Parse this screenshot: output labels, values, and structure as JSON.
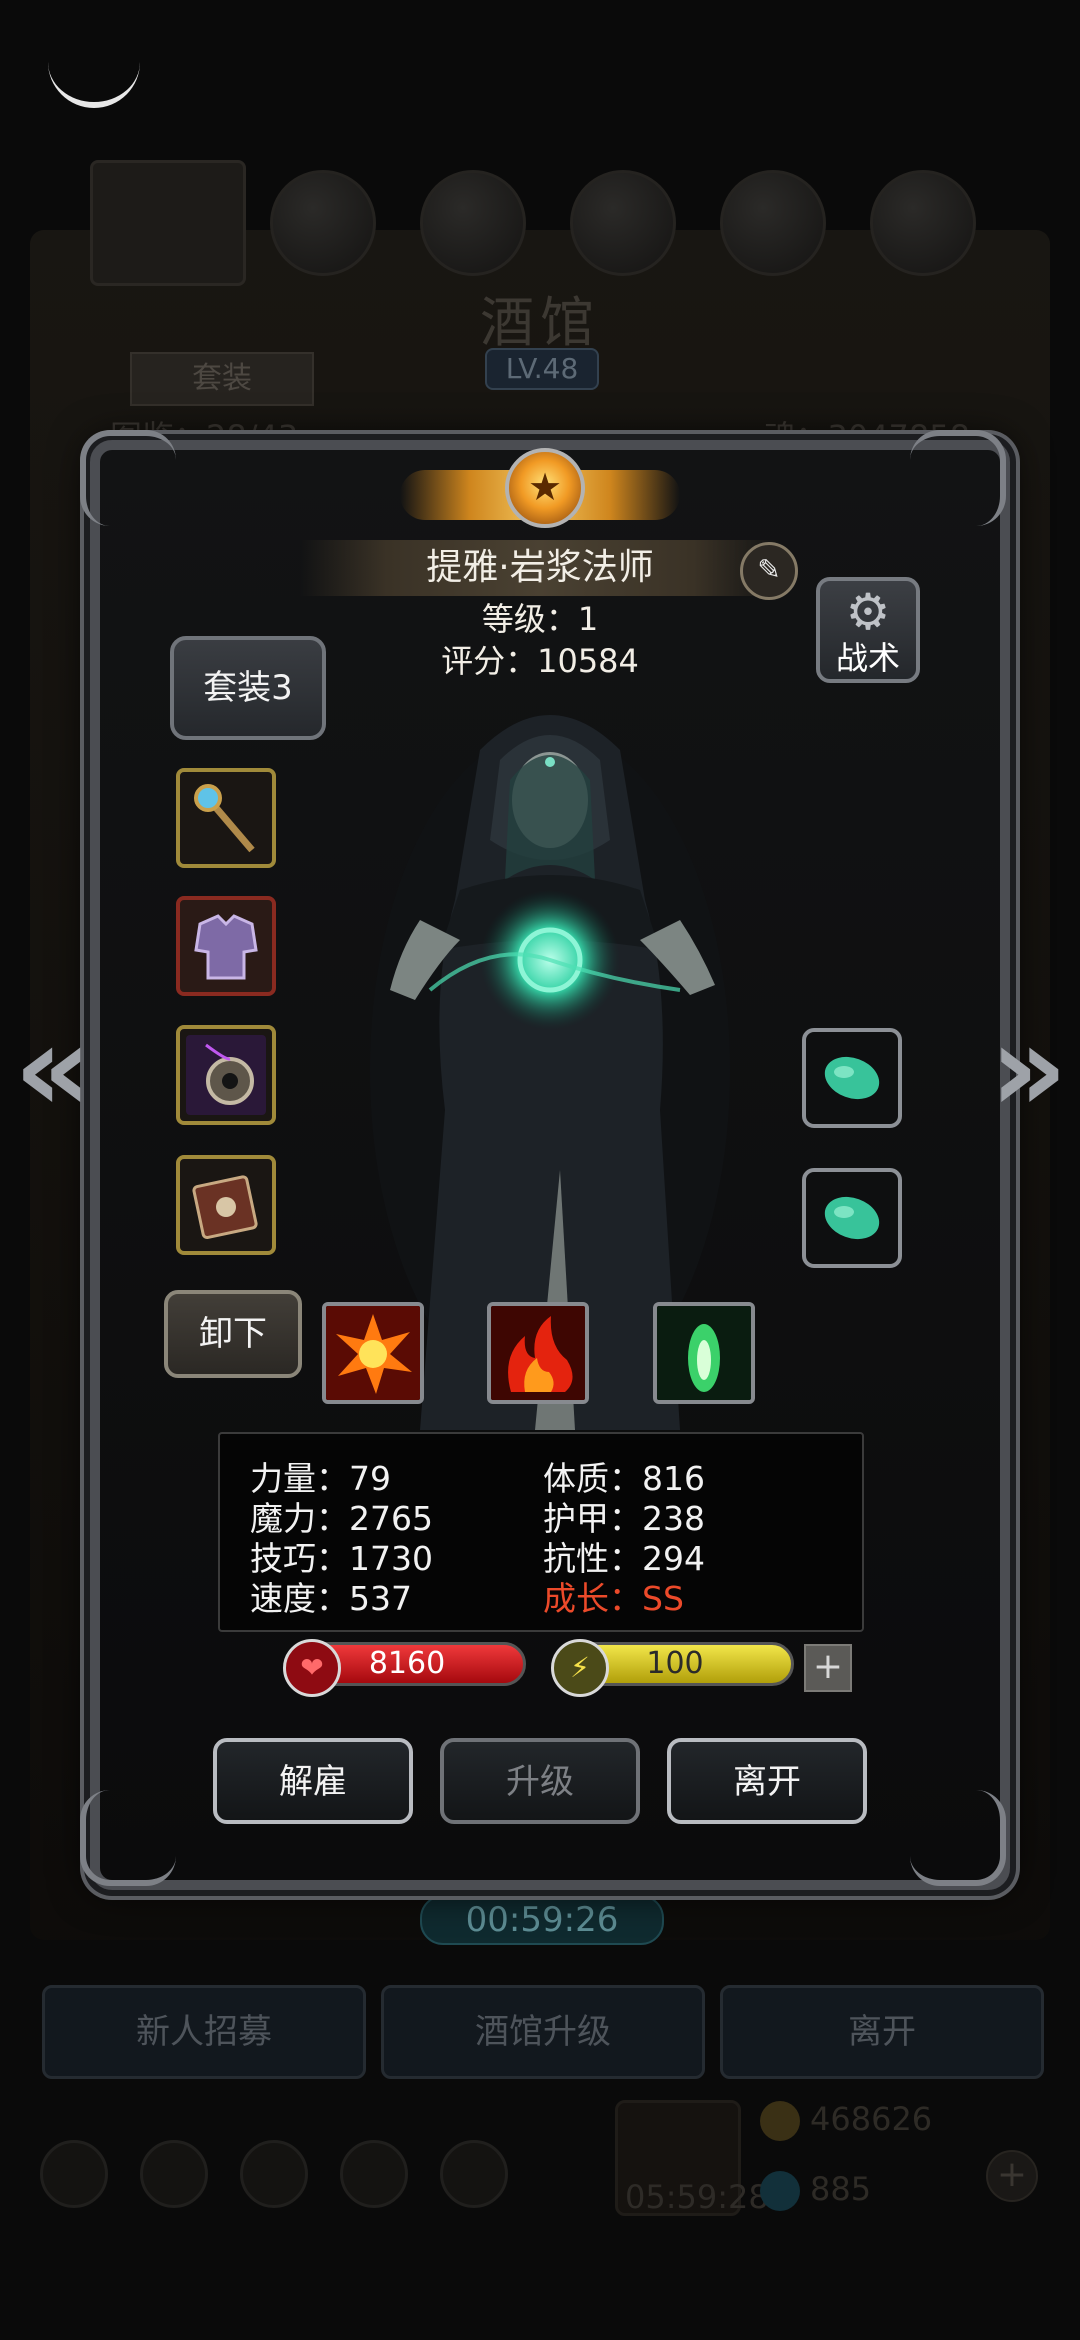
{
  "background": {
    "title": "酒馆",
    "level": "LV.48",
    "tab_label": "套装",
    "count_label": "图鉴：28/43",
    "soul_label": "魂：3047858",
    "timer": "00:59:26",
    "buttons": [
      "新人招募",
      "酒馆升级",
      "离开"
    ],
    "gift_timer": "05:59:28",
    "gold": "468626",
    "gems": "885"
  },
  "hero": {
    "name": "提雅·岩浆法师",
    "level_label": "等级：1",
    "score_label": "评分：10584",
    "set_button": "套装3",
    "tactics_button": "战术",
    "unequip_button": "卸下",
    "equipment": [
      "staff",
      "armor",
      "amulet",
      "book"
    ],
    "gems": [
      "jade-gem",
      "jade-gem"
    ],
    "skills": [
      "explosion",
      "fire",
      "green-flame"
    ]
  },
  "stats": {
    "left": [
      "力量：79",
      "魔力：2765",
      "技巧：1730",
      "速度：537"
    ],
    "right": [
      "体质：816",
      "护甲：238",
      "抗性：294"
    ],
    "growth": "成长：SS",
    "growth_color": "#ec4a2a"
  },
  "bars": {
    "hp": "8160",
    "energy": "100",
    "hp_color": "#d01e22",
    "energy_color": "#d8c414"
  },
  "actions": {
    "dismiss": "解雇",
    "upgrade": "升级",
    "leave": "离开"
  }
}
